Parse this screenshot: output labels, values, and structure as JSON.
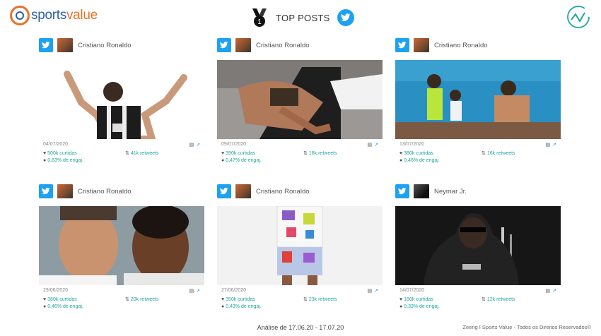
{
  "header": {
    "logo": {
      "part1": "sports",
      "part2": "value"
    },
    "title": "TOP POSTS",
    "medal_icon": "medal-first-place-icon",
    "twitter_icon": "twitter-bird-icon",
    "brand_icon": "trend-line-icon"
  },
  "cards": [
    {
      "author": "Cristiano Ronaldo",
      "date": "04/07/2020",
      "likes": "500k curtidas",
      "retweets": "41k retweets",
      "engagement": "0,63% de engaj."
    },
    {
      "author": "Cristiano Ronaldo",
      "date": "09/07/2020",
      "likes": "390k curtidas",
      "retweets": "18k retweets",
      "engagement": "0,47% de engaj."
    },
    {
      "author": "Cristiano Ronaldo",
      "date": "13/07/2020",
      "likes": "380k curtidas",
      "retweets": "16k retweets",
      "engagement": "0,46% de engaj."
    },
    {
      "author": "Cristiano Ronaldo",
      "date": "29/06/2020",
      "likes": "380k curtidas",
      "retweets": "20k retweets",
      "engagement": "0,46% de engaj."
    },
    {
      "author": "Cristiano Ronaldo",
      "date": "27/06/2020",
      "likes": "350k curtidas",
      "retweets": "23k retweets",
      "engagement": "0,43% de engaj."
    },
    {
      "author": "Neymar Jr.",
      "date": "14/07/2020",
      "likes": "180k curtidas",
      "retweets": "12k retweets",
      "engagement": "0,39% de engaj."
    }
  ],
  "footer": {
    "period": "Análise de 17.06.20 - 17.07.20",
    "rights": "Zeeng I Sports Value - Todos os Direitos Reservados©"
  },
  "colors": {
    "twitter": "#1da1f2",
    "accent_teal": "#1fa6a0",
    "brand_orange": "#e8722a",
    "brand_blue": "#2f5fa8"
  }
}
